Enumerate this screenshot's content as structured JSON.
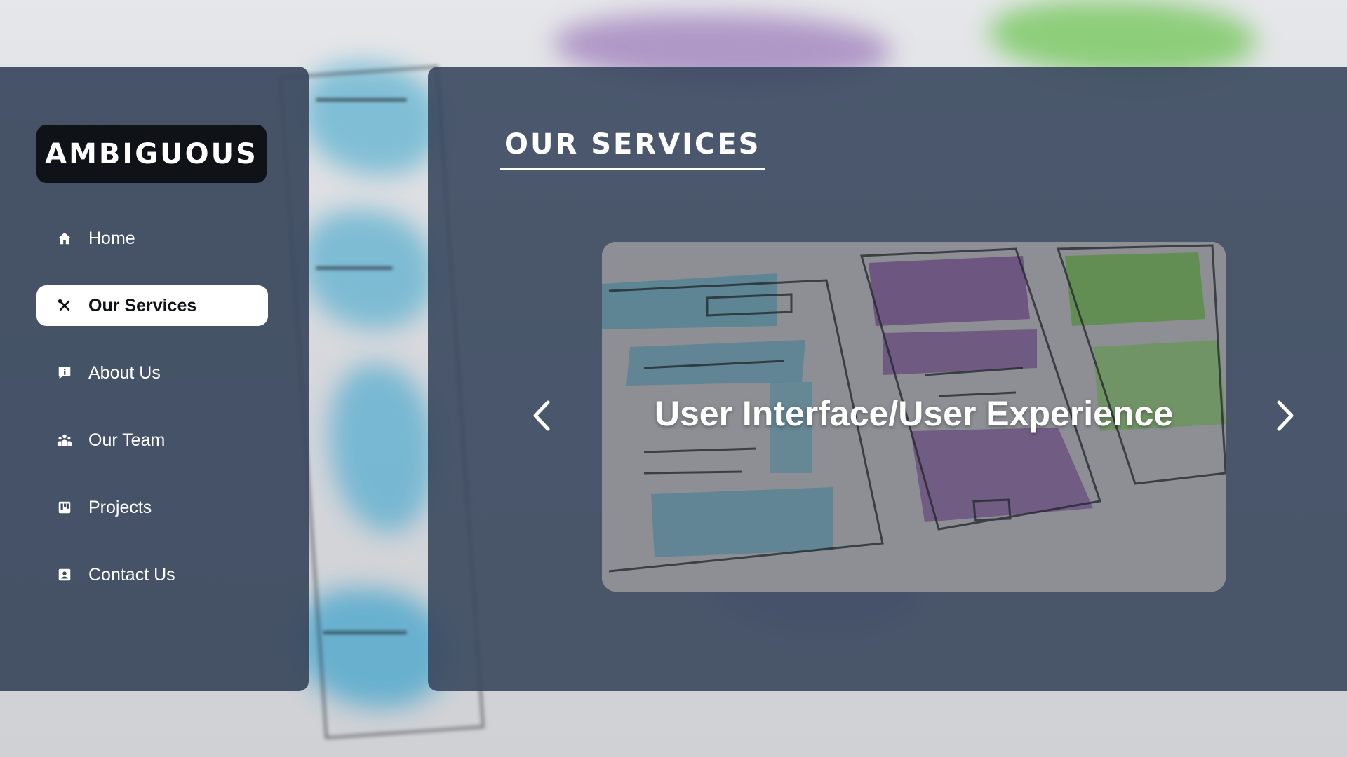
{
  "brand": {
    "logo_text": "AMBIGUOUS"
  },
  "nav": {
    "items": [
      {
        "label": "Home",
        "icon": "home-icon",
        "active": false
      },
      {
        "label": "Our Services",
        "icon": "tools-icon",
        "active": true
      },
      {
        "label": "About Us",
        "icon": "info-card-icon",
        "active": false
      },
      {
        "label": "Our Team",
        "icon": "team-icon",
        "active": false
      },
      {
        "label": "Projects",
        "icon": "projects-icon",
        "active": false
      },
      {
        "label": "Contact Us",
        "icon": "contact-icon",
        "active": false
      }
    ]
  },
  "main": {
    "heading": "OUR SERVICES",
    "carousel": {
      "current_slide_title": "User Interface/User Experience",
      "prev_icon": "chevron-left-icon",
      "next_icon": "chevron-right-icon"
    }
  },
  "colors": {
    "panel": "#3a485e",
    "logo_bg": "#0f1216",
    "active_nav_bg": "#ffffff",
    "text": "#ffffff"
  }
}
